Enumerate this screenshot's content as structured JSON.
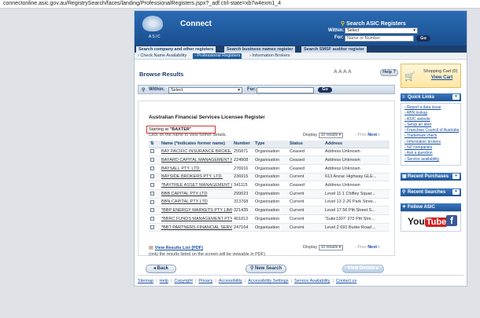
{
  "browser": {
    "url": "connectonline.asic.gov.au/RegistrySearch/faces/landing/ProfessionalRegisters.jspx?_adf.ctrl-state=xb7w4exm1_4"
  },
  "header": {
    "brand": "Connect",
    "logo_text": "ASIC",
    "search_title": "Search ASIC Registers",
    "within_label": "Within:",
    "within_value": "Select",
    "for_label": "For:",
    "for_placeholder": "Name or Number",
    "go_label": "Go"
  },
  "tabs": [
    {
      "label": "Search company and other registers"
    },
    {
      "label": "Search business names register"
    },
    {
      "label": "Search SMSF auditor register"
    }
  ],
  "subnav": [
    {
      "label": "Check Name Availability"
    },
    {
      "label": "Professional Registers"
    },
    {
      "label": "Information Brokers"
    }
  ],
  "browse": {
    "title": "Browse Results",
    "help_label": "Help",
    "within_label": "Within:",
    "within_value": "Select",
    "for_label": "For:",
    "go_label": "Go"
  },
  "register": {
    "title": "Australian Financial Services Licensee Register",
    "starting_prefix": "Starting at",
    "starting_value": "\"BAXTER\"",
    "click_hint": "Click on the name to view further details.",
    "display_label": "Display",
    "display_value": "10 results",
    "prev_label": "‹ Prev",
    "next_label": "Next ›",
    "columns": [
      "Name (*indicates former name)",
      "Number",
      "Type",
      "Status",
      "Address"
    ],
    "rows": [
      {
        "name": "BAY PACIFIC INSURANCE BROKE...",
        "number": "255871",
        "type": "Organisation",
        "status": "Ceased",
        "address": "Address Unknown"
      },
      {
        "name": "BAYARD CAPITAL MANAGEMENT P...",
        "number": "224908",
        "type": "Organisation",
        "status": "Ceased",
        "address": "Address Unknown"
      },
      {
        "name": "BAYSALL PTY. LTD.",
        "number": "276916",
        "type": "Organisation",
        "status": "Ceased",
        "address": "Address Unknown"
      },
      {
        "name": "BAYSIDE BROKERS PTY. LTD.",
        "number": "236915",
        "type": "Organisation",
        "status": "Current",
        "address": "613 Anzac Highway GLE..."
      },
      {
        "name": "*BAYTREE ASSET MANAGEMENT L...",
        "number": "341115",
        "type": "Organisation",
        "status": "Ceased",
        "address": "Address Unknown"
      },
      {
        "name": "BBB CAPITAL PTY LTD",
        "number": "299023",
        "type": "Organisation",
        "status": "Current",
        "address": "Level 11 1 Chifley Squar..."
      },
      {
        "name": "BBN CAPITAL PTY LTD",
        "number": "313768",
        "type": "Organisation",
        "status": "Current",
        "address": "Level 13 2-26 Park Stree..."
      },
      {
        "name": "*BBP ENERGY MARKETS PTY LIMI...",
        "number": "321435",
        "type": "Organisation",
        "status": "Current",
        "address": "Level 17 56 Pitt Street S..."
      },
      {
        "name": "*BBRC FUNDS MANAGEMENT PTY ...",
        "number": "401812",
        "type": "Organisation",
        "status": "Current",
        "address": "'Suite1307' 370 Pitt Stre..."
      },
      {
        "name": "*BBT PARTNERS FINANCIAL SERV...",
        "number": "247164",
        "type": "Organisation",
        "status": "Current",
        "address": "Level 2 691 Burke Road ..."
      }
    ],
    "view_list_label": "View Results List (PDF)",
    "note": "(only the results listed on the screen will be viewable in PDF)",
    "back_label": "Back",
    "new_search_label": "New Search",
    "view_details_label": "View Details"
  },
  "cart": {
    "title": "Shopping Cart (0)",
    "view_label": "View Cart"
  },
  "quick_links": {
    "title": "Quick Links",
    "items": [
      "Report a data issue",
      "ABN lookup",
      "ASIC website",
      "Setup an alert",
      "Franchise Council of Australia",
      "Trademark check",
      "Information brokers",
      "NZ companies",
      "Ask a question",
      "Service availability"
    ]
  },
  "recent_purchases": {
    "title": "Recent Purchases"
  },
  "recent_searches": {
    "title": "Recent Searches"
  },
  "follow": {
    "title": "Follow ASIC",
    "youtube_you": "You",
    "youtube_tube": "Tube",
    "facebook": "f"
  },
  "footer": {
    "links": [
      "Sitemap",
      "Help",
      "Copyright",
      "Privacy",
      "Accessibility",
      "Accessibility Settings",
      "Service Availability",
      "Contact us"
    ],
    "separator": "|"
  },
  "colors": {
    "header_blue": "#1a4f8e",
    "link_blue": "#1a4fa0",
    "highlight_red": "#d23434"
  }
}
